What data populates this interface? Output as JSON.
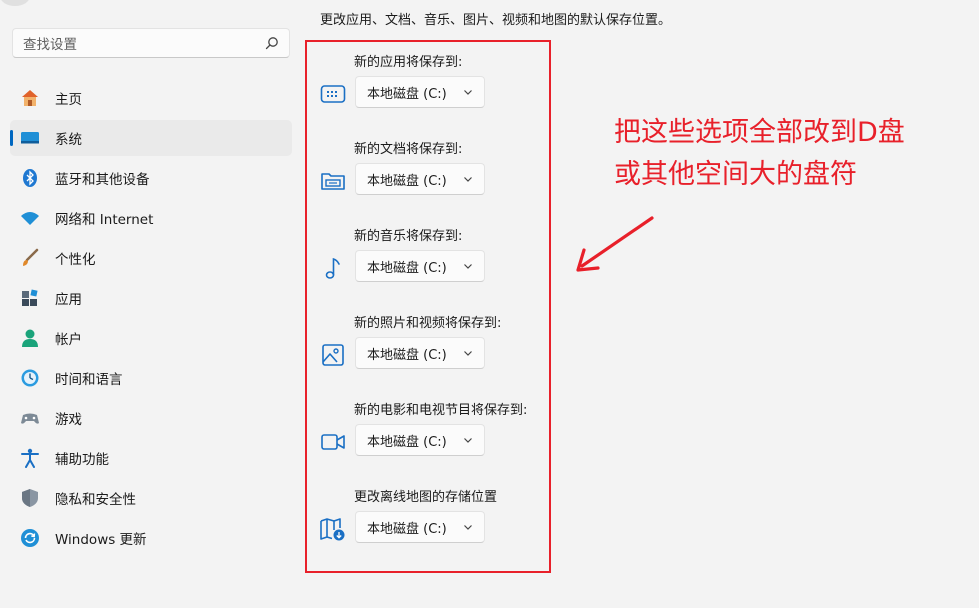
{
  "search": {
    "placeholder": "查找设置"
  },
  "nav": {
    "items": [
      {
        "label": "主页",
        "icon": "home-icon"
      },
      {
        "label": "系统",
        "icon": "system-icon",
        "selected": true
      },
      {
        "label": "蓝牙和其他设备",
        "icon": "bluetooth-icon"
      },
      {
        "label": "网络和 Internet",
        "icon": "wifi-icon"
      },
      {
        "label": "个性化",
        "icon": "brush-icon"
      },
      {
        "label": "应用",
        "icon": "apps-icon"
      },
      {
        "label": "帐户",
        "icon": "account-icon"
      },
      {
        "label": "时间和语言",
        "icon": "time-language-icon"
      },
      {
        "label": "游戏",
        "icon": "gaming-icon"
      },
      {
        "label": "辅助功能",
        "icon": "accessibility-icon"
      },
      {
        "label": "隐私和安全性",
        "icon": "shield-icon"
      },
      {
        "label": "Windows 更新",
        "icon": "update-icon"
      }
    ]
  },
  "main": {
    "description": "更改应用、文档、音乐、图片、视频和地图的默认保存位置。",
    "save_locations": [
      {
        "label": "新的应用将保存到:",
        "value": "本地磁盘 (C:)",
        "icon": "apps-storage-icon"
      },
      {
        "label": "新的文档将保存到:",
        "value": "本地磁盘 (C:)",
        "icon": "documents-folder-icon"
      },
      {
        "label": "新的音乐将保存到:",
        "value": "本地磁盘 (C:)",
        "icon": "music-note-icon"
      },
      {
        "label": "新的照片和视频将保存到:",
        "value": "本地磁盘 (C:)",
        "icon": "photo-icon"
      },
      {
        "label": "新的电影和电视节目将保存到:",
        "value": "本地磁盘 (C:)",
        "icon": "video-camera-icon"
      },
      {
        "label": "更改离线地图的存储位置",
        "value": "本地磁盘 (C:)",
        "icon": "map-download-icon"
      }
    ]
  },
  "annotation": {
    "line1": "把这些选项全部改到D盘",
    "line2": "或其他空间大的盘符",
    "color": "#e8202a"
  },
  "colors": {
    "accent": "#0067c0",
    "highlight_red": "#e8202a"
  }
}
